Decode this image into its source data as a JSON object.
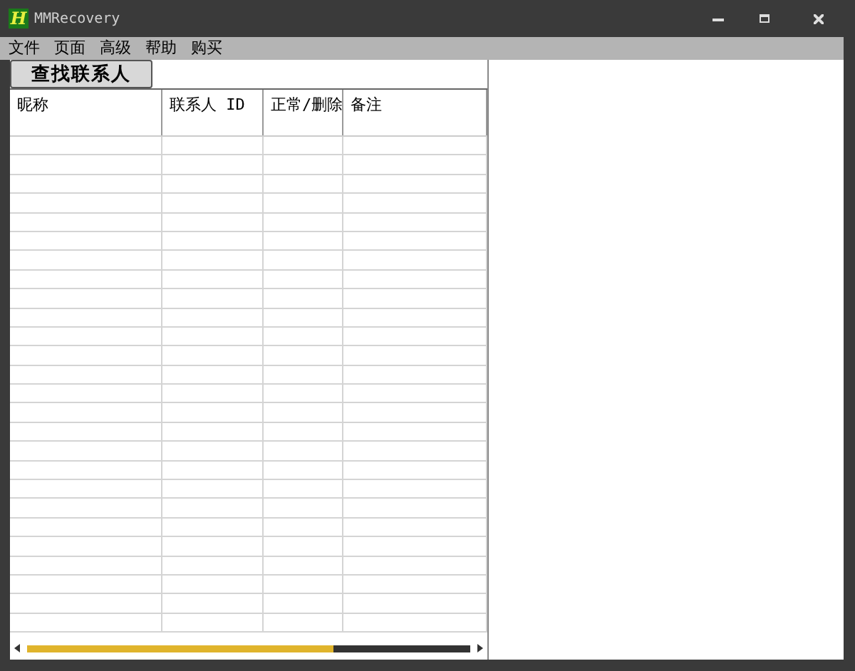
{
  "window": {
    "title": "MMRecovery",
    "logo": "H"
  },
  "menu": [
    "文件",
    "页面",
    "高级",
    "帮助",
    "购买"
  ],
  "toolbar": {
    "button": "查找联系人"
  },
  "table": {
    "columns": [
      "昵称",
      "联系人 ID",
      "正常/删除",
      "备注"
    ]
  }
}
